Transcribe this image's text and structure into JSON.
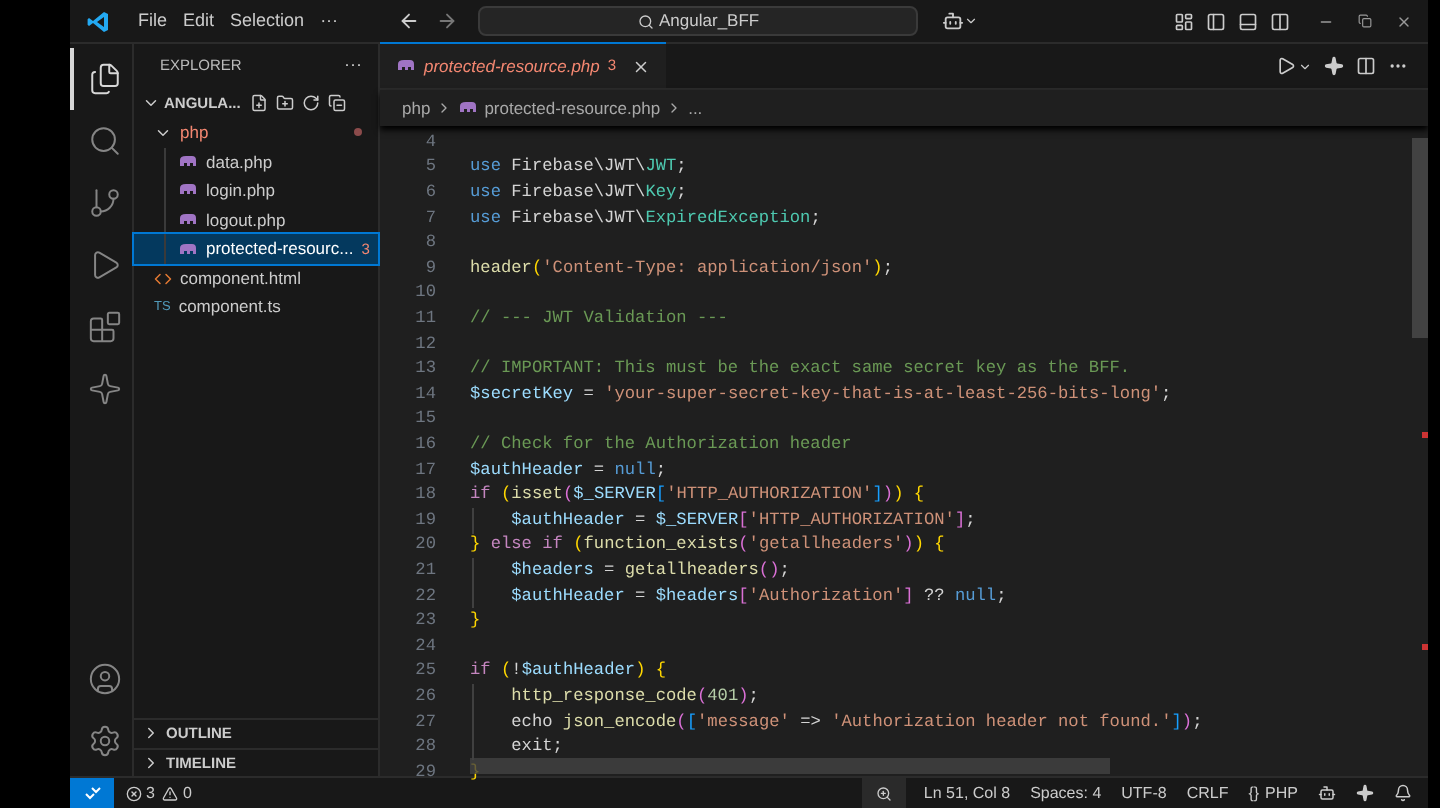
{
  "title_bar": {
    "menus": [
      "File",
      "Edit",
      "Selection",
      "···"
    ],
    "search": {
      "value": "Angular_BFF"
    }
  },
  "activity_bar": {
    "top": [
      {
        "kind": "explorer",
        "selected": true
      },
      {
        "kind": "search",
        "selected": false
      },
      {
        "kind": "source-control",
        "selected": false
      },
      {
        "kind": "run",
        "selected": false
      },
      {
        "kind": "extensions",
        "selected": false
      },
      {
        "kind": "sparkle",
        "selected": false
      }
    ],
    "bottom": [
      {
        "kind": "account",
        "selected": false
      },
      {
        "kind": "settings",
        "selected": false
      }
    ]
  },
  "sidebar": {
    "title": "EXPLORER",
    "more": "···",
    "root": {
      "label": "ANGULA...",
      "expanded": true
    },
    "tree": [
      {
        "label": "php",
        "kind": "folder",
        "expanded": true,
        "errors": true,
        "selected": false,
        "children": [
          {
            "label": "data.php",
            "kind": "php",
            "errors": false,
            "selected": false
          },
          {
            "label": "login.php",
            "kind": "php",
            "errors": false,
            "selected": false
          },
          {
            "label": "logout.php",
            "kind": "php",
            "errors": false,
            "selected": false
          },
          {
            "label": "protected-resourc...",
            "kind": "php",
            "errors": true,
            "badge": "3",
            "selected": true
          }
        ]
      },
      {
        "label": "component.html",
        "kind": "html",
        "errors": false,
        "selected": false
      },
      {
        "label": "component.ts",
        "kind": "ts",
        "type_label": "TS",
        "errors": false,
        "selected": false
      }
    ],
    "sections": [
      {
        "label": "OUTLINE",
        "expanded": false
      },
      {
        "label": "TIMELINE",
        "expanded": false
      }
    ]
  },
  "editor": {
    "tabs": [
      {
        "label": "protected-resource.php",
        "badge": "3",
        "selected": true,
        "preview": true
      }
    ],
    "breadcrumb": {
      "folder": "php",
      "file": "protected-resource.php",
      "rest": "..."
    },
    "lines": [
      {
        "number": "4"
      },
      {
        "number": "5",
        "tokens": [
          {
            "kind": "kw",
            "text": "use"
          },
          {
            "kind": "plain",
            "text": " Firebase\\JWT\\"
          },
          {
            "kind": "class",
            "text": "JWT"
          },
          {
            "kind": "plain",
            "text": ";"
          }
        ]
      },
      {
        "number": "6",
        "tokens": [
          {
            "kind": "kw",
            "text": "use"
          },
          {
            "kind": "plain",
            "text": " Firebase\\JWT\\"
          },
          {
            "kind": "class",
            "text": "Key"
          },
          {
            "kind": "plain",
            "text": ";"
          }
        ]
      },
      {
        "number": "7",
        "tokens": [
          {
            "kind": "kw",
            "text": "use"
          },
          {
            "kind": "plain",
            "text": " Firebase\\JWT\\"
          },
          {
            "kind": "class",
            "text": "ExpiredException"
          },
          {
            "kind": "plain",
            "text": ";"
          }
        ]
      },
      {
        "number": "8"
      },
      {
        "number": "9",
        "tokens": [
          {
            "kind": "fn",
            "text": "header"
          },
          {
            "kind": "br1",
            "text": "("
          },
          {
            "kind": "str",
            "text": "'Content-Type: application/json'"
          },
          {
            "kind": "br1",
            "text": ")"
          },
          {
            "kind": "plain",
            "text": ";"
          }
        ]
      },
      {
        "number": "10"
      },
      {
        "number": "11",
        "tokens": [
          {
            "kind": "comment",
            "text": "// --- JWT Validation ---"
          }
        ]
      },
      {
        "number": "12"
      },
      {
        "number": "13",
        "tokens": [
          {
            "kind": "comment",
            "text": "// IMPORTANT: This must be the exact same secret key as the BFF."
          }
        ]
      },
      {
        "number": "14",
        "tokens": [
          {
            "kind": "var",
            "text": "$secretKey"
          },
          {
            "kind": "plain",
            "text": " = "
          },
          {
            "kind": "str",
            "text": "'your-super-secret-key-that-is-at-least-256-bits-long'"
          },
          {
            "kind": "plain",
            "text": ";"
          }
        ]
      },
      {
        "number": "15"
      },
      {
        "number": "16",
        "tokens": [
          {
            "kind": "comment",
            "text": "// Check for the Authorization header"
          }
        ]
      },
      {
        "number": "17",
        "tokens": [
          {
            "kind": "var",
            "text": "$authHeader"
          },
          {
            "kind": "plain",
            "text": " = "
          },
          {
            "kind": "kw",
            "text": "null"
          },
          {
            "kind": "plain",
            "text": ";"
          }
        ]
      },
      {
        "number": "18",
        "tokens": [
          {
            "kind": "ctl",
            "text": "if "
          },
          {
            "kind": "br1",
            "text": "("
          },
          {
            "kind": "fn",
            "text": "isset"
          },
          {
            "kind": "br2",
            "text": "("
          },
          {
            "kind": "var",
            "text": "$_SERVER"
          },
          {
            "kind": "br3",
            "text": "["
          },
          {
            "kind": "str",
            "text": "'HTTP_AUTHORIZATION'"
          },
          {
            "kind": "br3",
            "text": "]"
          },
          {
            "kind": "br2",
            "text": ")"
          },
          {
            "kind": "br1",
            "text": ") {"
          }
        ]
      },
      {
        "number": "19",
        "tokens": [
          {
            "kind": "var",
            "text": "    $authHeader"
          },
          {
            "kind": "plain",
            "text": " = "
          },
          {
            "kind": "var",
            "text": "$_SERVER"
          },
          {
            "kind": "br2",
            "text": "["
          },
          {
            "kind": "str",
            "text": "'HTTP_AUTHORIZATION'"
          },
          {
            "kind": "br2",
            "text": "]"
          },
          {
            "kind": "plain",
            "text": ";"
          }
        ]
      },
      {
        "number": "20",
        "tokens": [
          {
            "kind": "br1",
            "text": "} "
          },
          {
            "kind": "ctl",
            "text": "else if "
          },
          {
            "kind": "br1",
            "text": "("
          },
          {
            "kind": "fn",
            "text": "function_exists"
          },
          {
            "kind": "br2",
            "text": "("
          },
          {
            "kind": "str",
            "text": "'getallheaders'"
          },
          {
            "kind": "br2",
            "text": ")"
          },
          {
            "kind": "br1",
            "text": ") {"
          }
        ]
      },
      {
        "number": "21",
        "tokens": [
          {
            "kind": "var",
            "text": "    $headers"
          },
          {
            "kind": "plain",
            "text": " = "
          },
          {
            "kind": "fn",
            "text": "getallheaders"
          },
          {
            "kind": "br2",
            "text": "()"
          },
          {
            "kind": "plain",
            "text": ";"
          }
        ]
      },
      {
        "number": "22",
        "tokens": [
          {
            "kind": "var",
            "text": "    $authHeader"
          },
          {
            "kind": "plain",
            "text": " = "
          },
          {
            "kind": "var",
            "text": "$headers"
          },
          {
            "kind": "br2",
            "text": "["
          },
          {
            "kind": "str",
            "text": "'Authorization'"
          },
          {
            "kind": "br2",
            "text": "]"
          },
          {
            "kind": "plain",
            "text": " ?? "
          },
          {
            "kind": "kw",
            "text": "null"
          },
          {
            "kind": "plain",
            "text": ";"
          }
        ]
      },
      {
        "number": "23",
        "tokens": [
          {
            "kind": "br1",
            "text": "}"
          }
        ]
      },
      {
        "number": "24"
      },
      {
        "number": "25",
        "tokens": [
          {
            "kind": "ctl",
            "text": "if "
          },
          {
            "kind": "br1",
            "text": "("
          },
          {
            "kind": "plain",
            "text": "!"
          },
          {
            "kind": "var",
            "text": "$authHeader"
          },
          {
            "kind": "br1",
            "text": ") {"
          }
        ]
      },
      {
        "number": "26",
        "tokens": [
          {
            "kind": "fn",
            "text": "    http_response_code"
          },
          {
            "kind": "br2",
            "text": "("
          },
          {
            "kind": "num",
            "text": "401"
          },
          {
            "kind": "br2",
            "text": ")"
          },
          {
            "kind": "plain",
            "text": ";"
          }
        ]
      },
      {
        "number": "27",
        "tokens": [
          {
            "kind": "plain",
            "text": "    echo "
          },
          {
            "kind": "fn",
            "text": "json_encode"
          },
          {
            "kind": "br2",
            "text": "("
          },
          {
            "kind": "br3",
            "text": "["
          },
          {
            "kind": "str",
            "text": "'message'"
          },
          {
            "kind": "plain",
            "text": " => "
          },
          {
            "kind": "str",
            "text": "'Authorization header not found.'"
          },
          {
            "kind": "br3",
            "text": "]"
          },
          {
            "kind": "br2",
            "text": ")"
          },
          {
            "kind": "plain",
            "text": ";"
          }
        ]
      },
      {
        "number": "28",
        "tokens": [
          {
            "kind": "plain",
            "text": "    exit;"
          }
        ]
      },
      {
        "number": "29",
        "tokens": [
          {
            "kind": "br1",
            "text": "}"
          }
        ]
      }
    ]
  },
  "status_bar": {
    "errors": "3",
    "warnings": "0",
    "items": [
      "Ln 51, Col 8",
      "Spaces: 4",
      "UTF-8",
      "CRLF"
    ],
    "language": "PHP",
    "language_prefix": "{}"
  }
}
